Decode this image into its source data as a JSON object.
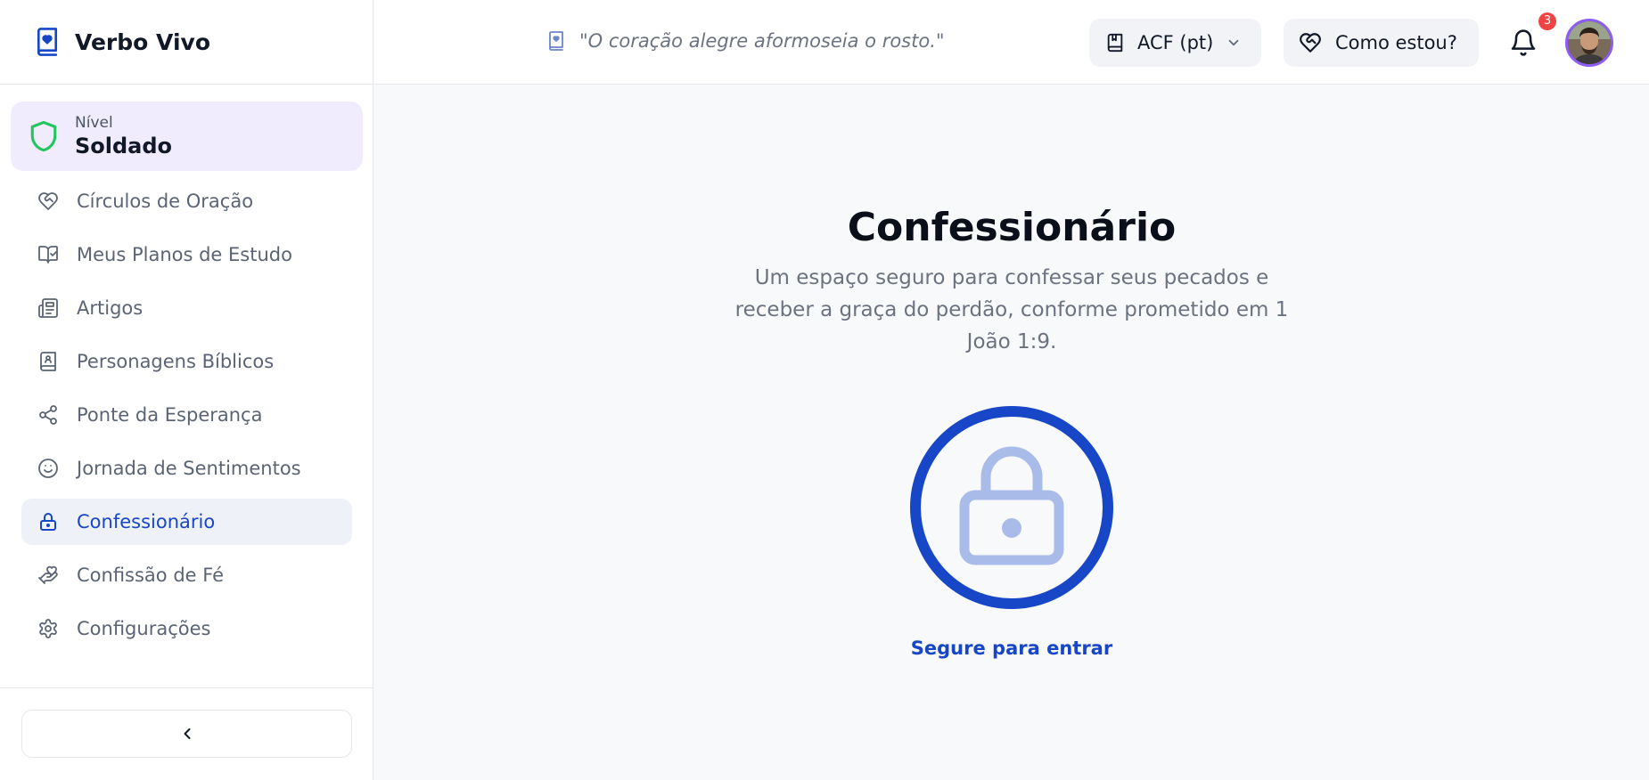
{
  "app": {
    "name": "Verbo Vivo"
  },
  "level": {
    "label": "Nível",
    "value": "Soldado"
  },
  "nav": {
    "items": [
      {
        "label": "Círculos de Oração",
        "icon": "heart-handshake-icon"
      },
      {
        "label": "Meus Planos de Estudo",
        "icon": "book-check-icon"
      },
      {
        "label": "Artigos",
        "icon": "newspaper-icon"
      },
      {
        "label": "Personagens Bíblicos",
        "icon": "book-user-icon"
      },
      {
        "label": "Ponte da Esperança",
        "icon": "share-icon"
      },
      {
        "label": "Jornada de Sentimentos",
        "icon": "smile-icon"
      },
      {
        "label": "Confessionário",
        "icon": "lock-icon",
        "active": true
      },
      {
        "label": "Confissão de Fé",
        "icon": "hand-heart-icon"
      },
      {
        "label": "Configurações",
        "icon": "gear-icon"
      }
    ]
  },
  "header": {
    "verse": "\"O coração alegre aformoseia o rosto.\"",
    "version": "ACF (pt)",
    "mood_button": "Como estou?",
    "notifications_count": "3"
  },
  "main": {
    "title": "Confessionário",
    "description": "Um espaço seguro para confessar seus pecados e receber a graça do perdão, conforme prometido em 1 João 1:9.",
    "action": "Segure para entrar"
  },
  "colors": {
    "accent": "#1746c6",
    "level_card_bg": "#f1ecfd",
    "shield": "#22c55e",
    "badge": "#ef4444"
  }
}
